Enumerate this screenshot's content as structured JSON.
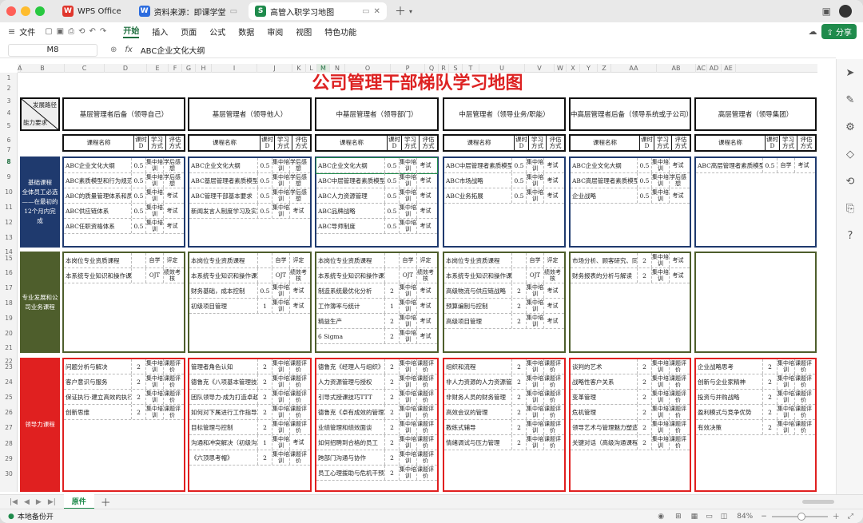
{
  "tabs": [
    {
      "label": "WPS Office",
      "icon": "wps-logo-icon",
      "color": "#e0362c"
    },
    {
      "label": "资料来源：即课学堂",
      "icon": "doc-icon",
      "color": "#2c6cde"
    },
    {
      "label": "高管入职学习地图",
      "icon": "sheet-icon",
      "color": "#1f8b4c"
    }
  ],
  "toolbar": {
    "file": "文件",
    "menus": [
      "开始",
      "插入",
      "页面",
      "公式",
      "数据",
      "审阅",
      "视图",
      "特色功能"
    ],
    "share": "分享"
  },
  "formula": {
    "cell": "M8",
    "fx": "fx",
    "value": "ABC企业文化大纲"
  },
  "columns": [
    "A",
    "B",
    "C",
    "D",
    "E",
    "F",
    "G",
    "H",
    "I",
    "J",
    "K",
    "L",
    "M",
    "N",
    "O",
    "P",
    "Q",
    "R",
    "S",
    "T",
    "U",
    "V",
    "W",
    "X",
    "Y",
    "Z",
    "AA",
    "AB",
    "AC",
    "AD",
    "AE"
  ],
  "rows": [
    "1",
    "2",
    "3",
    "4",
    "5",
    "6",
    "7",
    "8",
    "9",
    "10",
    "11",
    "12",
    "13",
    "14",
    "15",
    "16",
    "17",
    "18",
    "19",
    "20",
    "21",
    "22",
    "23",
    "24",
    "25",
    "26",
    "27",
    "28",
    "29",
    "30"
  ],
  "sheet": {
    "title": "公司管理干部梯队学习地图",
    "corner_top": "发展路径",
    "corner_bottom": "能力要求",
    "levels": [
      "基层管理者后备（领导自己）",
      "基层管理者（领导他人）",
      "中基层管理者（领导部门）",
      "中层管理者（领导业务/职能）",
      "中高层管理者后备（领导系统或子公司）",
      "高层管理者（领导集团）"
    ],
    "headers": {
      "name": "课程名称",
      "hours": "课时D",
      "mode": "学习方式",
      "eval": "评估方式"
    },
    "sections": [
      {
        "label": "基础课程\n全体员工必选\n——在最初的\n12个月内完成",
        "color": "#1f3a6e"
      },
      {
        "label": "专业发展和公\n司业务课程",
        "color": "#4e5e2c"
      },
      {
        "label": "领导力课程",
        "color": "#e02020"
      }
    ],
    "basic": [
      [
        [
          "ABC企业文化大纲",
          "0.5",
          "集中培训",
          "学后感想"
        ],
        [
          "ABC素质模型和行为规范",
          "0.5",
          "集中培训",
          "学后感想"
        ],
        [
          "ABC的质量管理体系和质量意识",
          "0.5",
          "集中培训",
          "考试"
        ],
        [
          "ABC供应链体系",
          "0.5",
          "集中培训",
          "考试"
        ],
        [
          "ABC任职资格体系",
          "0.5",
          "集中培训",
          "考试"
        ]
      ],
      [
        [
          "ABC企业文化大纲",
          "0.5",
          "集中培训",
          "学后感想"
        ],
        [
          "ABC基层管理者素质模型",
          "0.5",
          "集中培训",
          "学后感想"
        ],
        [
          "ABC管理干部基本要求",
          "0.5",
          "集中培训",
          "学后感想"
        ],
        [
          "新闻发言人制度学习及实践技巧",
          "0.5",
          "集中培训",
          "考试"
        ]
      ],
      [
        [
          "ABC企业文化大纲",
          "0.5",
          "集中培训",
          "考试"
        ],
        [
          "ABC中层管理者素质模型",
          "0.5",
          "集中培训",
          "考试"
        ],
        [
          "ABC人力资源管理",
          "0.5",
          "集中培训",
          "考试"
        ],
        [
          "ABC品牌战略",
          "0.5",
          "集中培训",
          "考试"
        ],
        [
          "ABC导师制度",
          "0.5",
          "集中培训",
          "考试"
        ]
      ],
      [
        [
          "ABC中层管理者素质模型",
          "0.5",
          "集中培训",
          "考试"
        ],
        [
          "ABC市场战略",
          "0.5",
          "集中培训",
          "考试"
        ],
        [
          "ABC业务拓展",
          "0.5",
          "集中培训",
          "考试"
        ]
      ],
      [
        [
          "ABC企业文化大纲",
          "0.5",
          "集中培训",
          "考试"
        ],
        [
          "ABC高层管理者素质模型",
          "0.5",
          "集中培训",
          "学后感想"
        ],
        [
          "企业战略",
          "0.5",
          "集中培训",
          "考试"
        ]
      ],
      [
        [
          "ABC高层管理者素质模型",
          "0.5",
          "自学",
          "考试"
        ]
      ]
    ],
    "professional": [
      [
        [
          "本岗位专业资质课程",
          "",
          "自学",
          "评定"
        ],
        [
          "本系统专业知识和操作课程",
          "",
          "OJT",
          "绩效考核"
        ]
      ],
      [
        [
          "本岗位专业资质课程",
          "",
          "自学",
          "评定"
        ],
        [
          "本系统专业知识和操作课程",
          "",
          "OJT",
          "绩效考核"
        ],
        [
          "财务基础，成本控制",
          "0.5",
          "集中培训",
          "考试"
        ],
        [
          "初级项目管理",
          "1",
          "集中培训",
          "考试"
        ]
      ],
      [
        [
          "本岗位专业资质课程",
          "",
          "自学",
          "评定"
        ],
        [
          "本系统专业知识和操作课程",
          "",
          "OJT",
          "绩效考核"
        ],
        [
          "制造系统最优化分析",
          "2",
          "集中培训",
          "考试"
        ],
        [
          "工作簿率与统计",
          "1",
          "集中培训",
          "考试"
        ],
        [
          "精益生产",
          "2",
          "集中培训",
          "考试"
        ],
        [
          "6 Sigma",
          "2",
          "集中培训",
          "考试"
        ]
      ],
      [
        [
          "本岗位专业资质课程",
          "",
          "自学",
          "评定"
        ],
        [
          "本系统专业知识和操作课程",
          "",
          "OJT",
          "绩效考核"
        ],
        [
          "高级物流与供应链战略",
          "2",
          "集中培训",
          "考试"
        ],
        [
          "预算编制与控制",
          "2",
          "集中培训",
          "考试"
        ],
        [
          "高级项目管理",
          "2",
          "集中培训",
          "考试"
        ]
      ],
      [
        [
          "市场分析、顾客研究、同行业",
          "2",
          "集中培训",
          "考试"
        ],
        [
          "财务报表的分析与解读",
          "2",
          "集中培训",
          "考试"
        ]
      ],
      []
    ],
    "leadership": [
      [
        [
          "问题分析与解决",
          "2",
          "集中培训",
          "课题评价"
        ],
        [
          "客户意识与服务",
          "2",
          "集中培训",
          "课题评价"
        ],
        [
          "保证执行·建立高效的执行力",
          "2",
          "集中培训",
          "课题评价"
        ],
        [
          "创新思维",
          "2",
          "集中培训",
          "课题评价"
        ]
      ],
      [
        [
          "管理者角色认知",
          "2",
          "集中培训",
          "课题评价"
        ],
        [
          "德鲁克《八项基本管理技能》",
          "2",
          "集中培训",
          "课题评价"
        ],
        [
          "团队领导力·成为打造卓越团队的领导者",
          "2",
          "集中培训",
          "课题评价"
        ],
        [
          "如何对下属进行工作指导和反馈",
          "2",
          "集中培训",
          "课题评价"
        ],
        [
          "目标管理与控制",
          "2",
          "集中培训",
          "课题评价"
        ],
        [
          "沟通和冲突解决（初级沟通课程）",
          "1",
          "集中培训",
          "考试"
        ],
        [
          "《六顶思考帽》",
          "2",
          "集中培训",
          "课题评价"
        ]
      ],
      [
        [
          "德鲁克《经理人与组织》－为企业打造合格的职业经理",
          "2",
          "集中培训",
          "课题评价"
        ],
        [
          "人力资源管理与授权",
          "2",
          "集中培训",
          "课题评价"
        ],
        [
          "引导式授课技巧TTT",
          "2",
          "集中培训",
          "课题评价"
        ],
        [
          "德鲁克《卓有成效的管理者》",
          "2",
          "集中培训",
          "课题评价"
        ],
        [
          "业绩管理和绩效面谈",
          "2",
          "集中培训",
          "课题评价"
        ],
        [
          "如何招聘到合格的员工",
          "2",
          "集中培训",
          "课题评价"
        ],
        [
          "跨部门沟通与协作",
          "2",
          "集中培训",
          "课题评价"
        ],
        [
          "员工心理援助与危机干预《让员工调查》",
          "2",
          "集中培训",
          "课题评价"
        ]
      ],
      [
        [
          "组织和流程",
          "2",
          "集中培训",
          "课题评价"
        ],
        [
          "非人力资源的人力资源管理",
          "2",
          "集中培训",
          "课题评价"
        ],
        [
          "非财务人员的财务管理",
          "2",
          "集中培训",
          "课题评价"
        ],
        [
          "高效会议的管理",
          "2",
          "集中培训",
          "课题评价"
        ],
        [
          "教练式辅导",
          "2",
          "集中培训",
          "课题评价"
        ],
        [
          "情绪调试与压力管理",
          "2",
          "集中培训",
          "课题评价"
        ]
      ],
      [
        [
          "谈判的艺术",
          "2",
          "集中培训",
          "课题评价"
        ],
        [
          "战略性客户关系",
          "2",
          "集中培训",
          "课题评价"
        ],
        [
          "变革管理",
          "2",
          "集中培训",
          "课题评价"
        ],
        [
          "危机管理",
          "2",
          "集中培训",
          "课题评价"
        ],
        [
          "领导艺术与管理魅力塑造",
          "2",
          "集中培训",
          "课题评价"
        ],
        [
          "关键对话（高级沟通课程）",
          "2",
          "集中培训",
          "课题评价"
        ]
      ],
      [
        [
          "企业战略思考",
          "2",
          "集中培训",
          "课题评价"
        ],
        [
          "创新与企业家精神",
          "2",
          "集中培训",
          "课题评价"
        ],
        [
          "投资与并购战略",
          "2",
          "集中培训",
          "课题评价"
        ],
        [
          "盈利模式与竞争优势",
          "2",
          "集中培训",
          "课题评价"
        ],
        [
          "有效决策",
          "2",
          "集中培训",
          "课题评价"
        ]
      ]
    ]
  },
  "sheet_tab": "原件",
  "status": {
    "backup": "本地备份开",
    "zoom": "84%"
  }
}
